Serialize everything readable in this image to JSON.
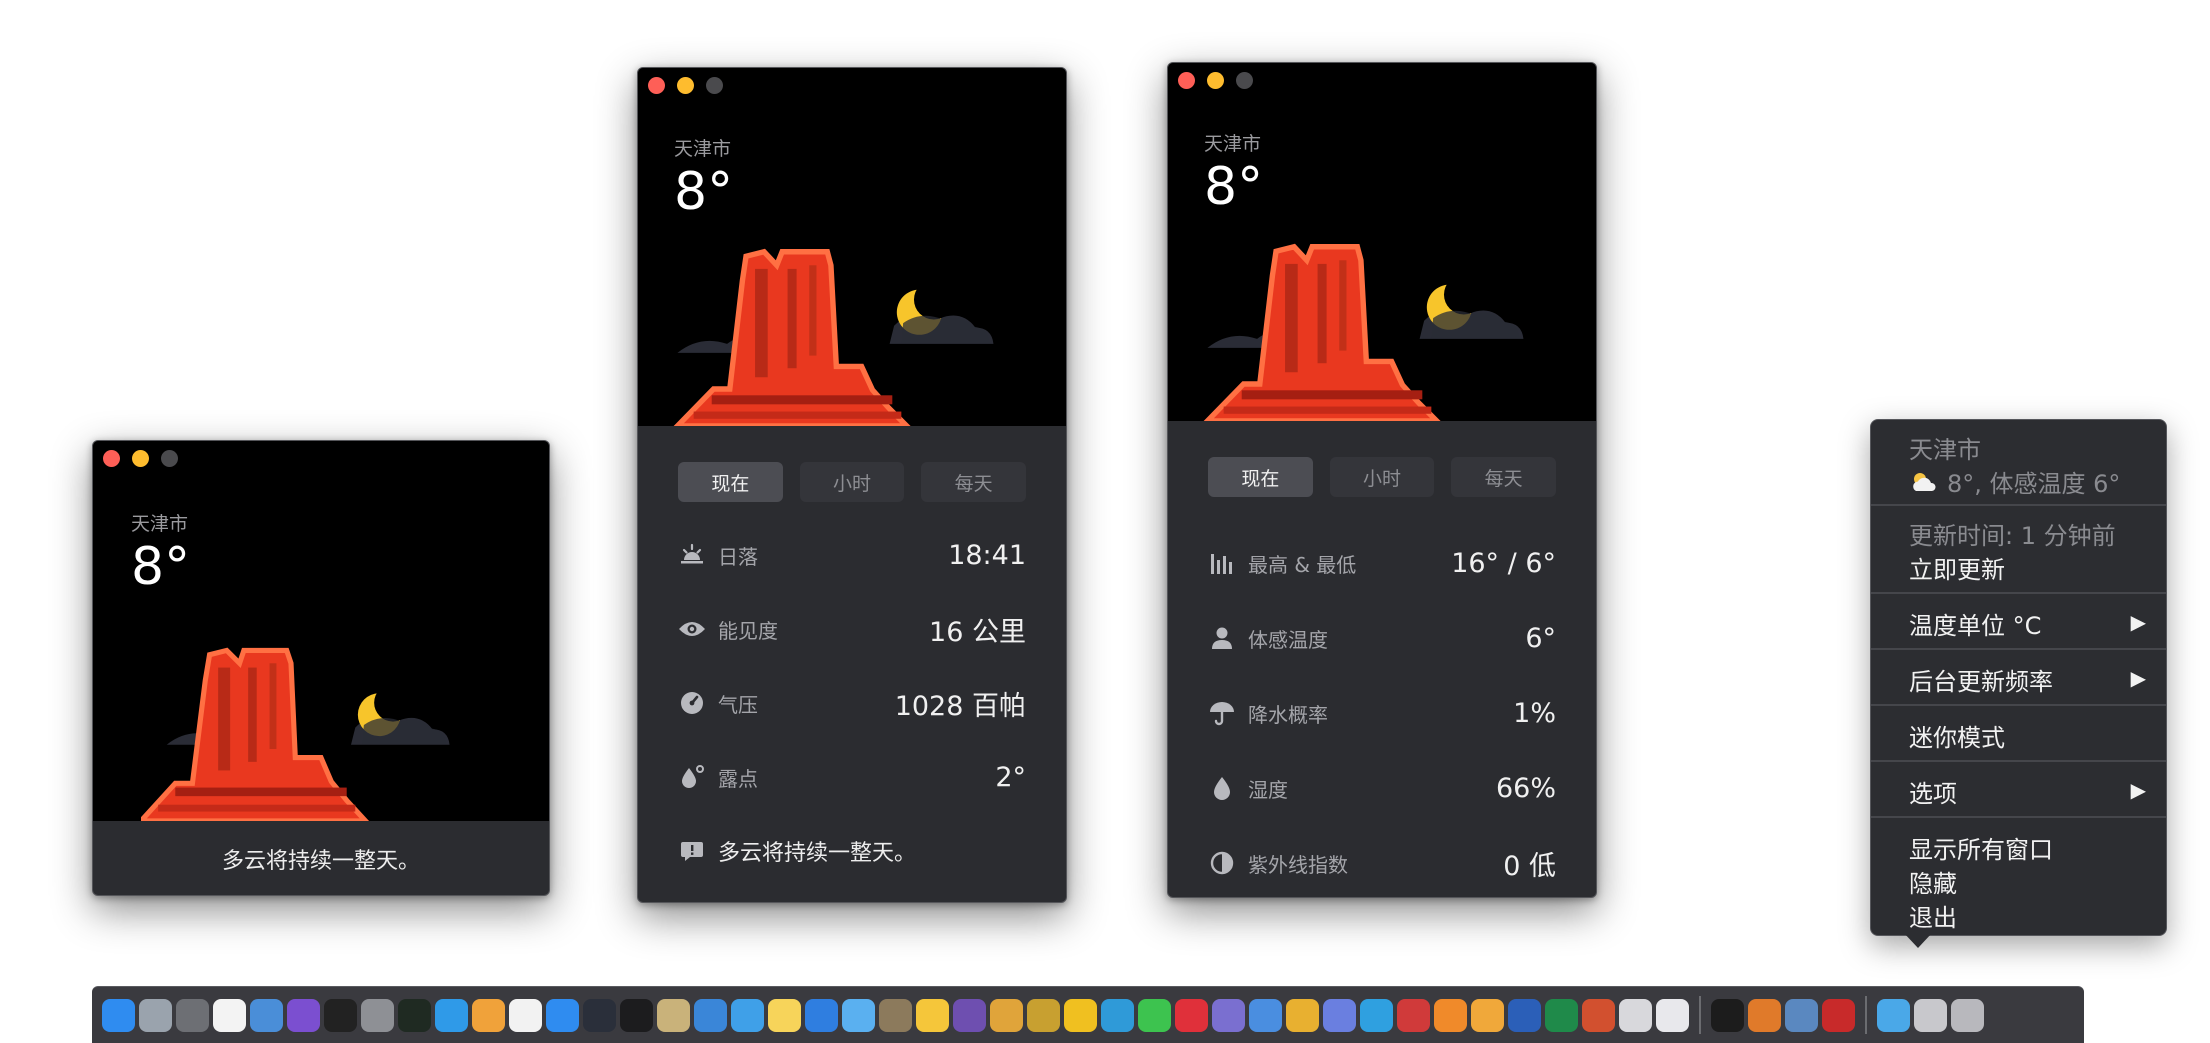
{
  "windows": {
    "mini": {
      "city": "天津市",
      "temp": "8°",
      "summary": "多云将持续一整天。"
    },
    "now": {
      "city": "天津市",
      "temp": "8°",
      "tabs": [
        "现在",
        "小时",
        "每天"
      ],
      "active_tab": "现在",
      "rows": [
        {
          "icon": "sunset-icon",
          "label": "日落",
          "value": "18:41"
        },
        {
          "icon": "eye-icon",
          "label": "能见度",
          "value": "16 公里"
        },
        {
          "icon": "pressure-gauge-icon",
          "label": "气压",
          "value": "1028 百帕"
        },
        {
          "icon": "dewpoint-icon",
          "label": "露点",
          "value": "2°"
        }
      ],
      "summary": "多云将持续一整天。"
    },
    "details": {
      "city": "天津市",
      "temp": "8°",
      "tabs": [
        "现在",
        "小时",
        "每天"
      ],
      "active_tab": "现在",
      "rows": [
        {
          "icon": "bar-chart-icon",
          "label": "最高 & 最低",
          "value": "16° / 6°"
        },
        {
          "icon": "person-icon",
          "label": "体感温度",
          "value": "6°"
        },
        {
          "icon": "umbrella-icon",
          "label": "降水概率",
          "value": "1%"
        },
        {
          "icon": "water-drop-icon",
          "label": "湿度",
          "value": "66%"
        },
        {
          "icon": "half-circle-icon",
          "label": "紫外线指数",
          "value": "0 低"
        }
      ]
    }
  },
  "menu": {
    "city": "天津市",
    "conditions": "8°, 体感温度 6°",
    "updated": "更新时间: 1 分钟前",
    "update_now": "立即更新",
    "temp_unit": "温度单位 °C",
    "bg_frequency": "后台更新频率",
    "mini_mode": "迷你模式",
    "options": "选项",
    "show_all": "显示所有窗口",
    "hide": "隐藏",
    "quit": "退出",
    "submenu_arrow": "▶"
  },
  "dock": {
    "icons": [
      {
        "name": "finder-icon",
        "color": "#2f8cf0"
      },
      {
        "name": "launchpad-icon",
        "color": "#9aa3ad"
      },
      {
        "name": "keychain-icon",
        "color": "#6d6f74"
      },
      {
        "name": "calendar-icon",
        "color": "#f3f3f3"
      },
      {
        "name": "preview-icon",
        "color": "#4a8ed8"
      },
      {
        "name": "imovie-icon",
        "color": "#7b4fd0"
      },
      {
        "name": "terminal-icon",
        "color": "#222222"
      },
      {
        "name": "system-preferences-icon",
        "color": "#8e9095"
      },
      {
        "name": "activity-monitor-icon",
        "color": "#1f2a22"
      },
      {
        "name": "safari-icon",
        "color": "#2f9ae8"
      },
      {
        "name": "photos-icon",
        "color": "#f0a23a"
      },
      {
        "name": "music-icon",
        "color": "#f2f2f2"
      },
      {
        "name": "app-store-icon",
        "color": "#2f8cf0"
      },
      {
        "name": "calculator-icon",
        "color": "#2a2f3a"
      },
      {
        "name": "screenshot-icon",
        "color": "#1c1c1e"
      },
      {
        "name": "script-editor-icon",
        "color": "#c9b27a"
      },
      {
        "name": "bird-app-icon",
        "color": "#3a86d8"
      },
      {
        "name": "mail-app-icon",
        "color": "#3fa0e8"
      },
      {
        "name": "notes-icon",
        "color": "#f7d45a"
      },
      {
        "name": "tasks-icon",
        "color": "#2f7ee0"
      },
      {
        "name": "snowflake-app-icon",
        "color": "#5ab0f0"
      },
      {
        "name": "package-icon",
        "color": "#8c7a5c"
      },
      {
        "name": "emoji-icon",
        "color": "#f5c63a"
      },
      {
        "name": "bbedit-icon",
        "color": "#6e4fb0"
      },
      {
        "name": "comics-icon",
        "color": "#e0a43a"
      },
      {
        "name": "gold-book-icon",
        "color": "#c8a030"
      },
      {
        "name": "butterfly-icon",
        "color": "#f0c020"
      },
      {
        "name": "edge-icon",
        "color": "#2f9ad8"
      },
      {
        "name": "wechat-icon",
        "color": "#3dc34f"
      },
      {
        "name": "netease-music-icon",
        "color": "#e0303a"
      },
      {
        "name": "istat-icon",
        "color": "#7a6fd0"
      },
      {
        "name": "airmail-icon",
        "color": "#4a8ee0"
      },
      {
        "name": "chrome-icon",
        "color": "#e8b030"
      },
      {
        "name": "vpn-shield-icon",
        "color": "#6a7fe0"
      },
      {
        "name": "telegram-icon",
        "color": "#2fa0e0"
      },
      {
        "name": "red-mac-icon",
        "color": "#d03a3a"
      },
      {
        "name": "infuse-icon",
        "color": "#f08a2a"
      },
      {
        "name": "pages-icon",
        "color": "#f0a83a"
      },
      {
        "name": "word-icon",
        "color": "#2b5fb8"
      },
      {
        "name": "excel-icon",
        "color": "#1f8a4a"
      },
      {
        "name": "powerpoint-icon",
        "color": "#d2502f"
      },
      {
        "name": "ghost-icon",
        "color": "#d8d8dc"
      },
      {
        "name": "vector-a-icon",
        "color": "#e8e8ec"
      },
      {
        "name": "qq-penguin-icon",
        "color": "#1c1c1c"
      },
      {
        "name": "paint-icon",
        "color": "#e07a2a"
      },
      {
        "name": "monitor-icon",
        "color": "#5a88c0"
      },
      {
        "name": "ladybug-icon",
        "color": "#c82a2a"
      },
      {
        "name": "downloads-folder-icon",
        "color": "#4aa8e8"
      },
      {
        "name": "desktop-icon",
        "color": "#c8c8cc"
      },
      {
        "name": "trash-icon",
        "color": "#b8b8bd"
      }
    ]
  }
}
